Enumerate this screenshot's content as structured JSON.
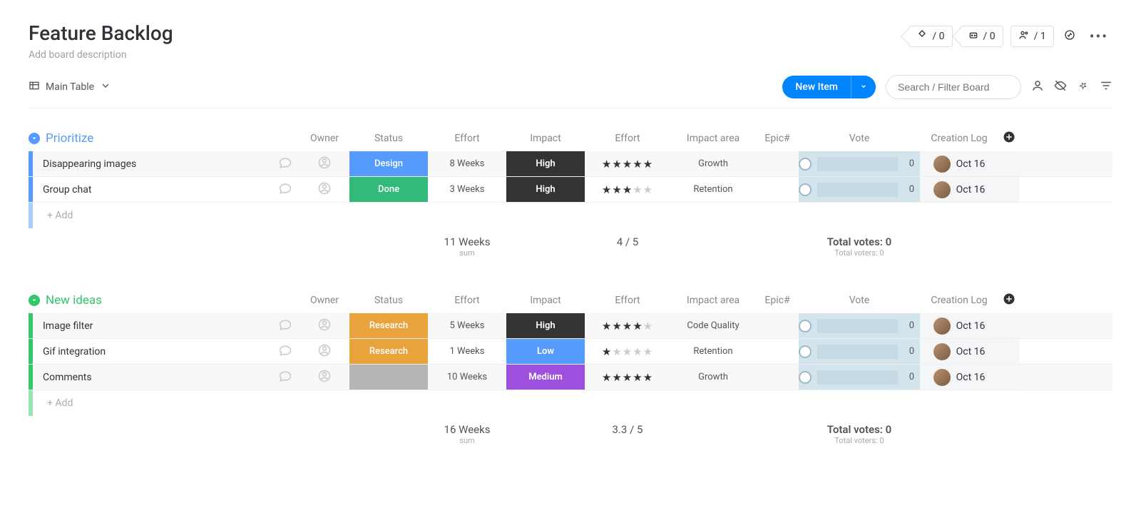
{
  "header": {
    "title": "Feature Backlog",
    "description": "Add board description"
  },
  "topchips": {
    "chip1": "/ 0",
    "chip2": "/ 0",
    "chip3": "/ 1"
  },
  "toolbar": {
    "view": "Main Table",
    "new_item": "New Item",
    "search_placeholder": "Search / Filter Board"
  },
  "columns": [
    "Owner",
    "Status",
    "Effort",
    "Impact",
    "Effort",
    "Impact area",
    "Epic#",
    "Vote",
    "Creation Log"
  ],
  "groups": [
    {
      "name": "Prioritize",
      "color": "#579bfc",
      "rows": [
        {
          "title": "Disappearing images",
          "status": "Design",
          "status_color": "#579bfc",
          "effort": "8 Weeks",
          "impact": "High",
          "impact_color": "#333333",
          "stars": 5,
          "impact_area": "Growth",
          "epic": "",
          "vote": "0",
          "date": "Oct 16"
        },
        {
          "title": "Group chat",
          "status": "Done",
          "status_color": "#33b97a",
          "effort": "3 Weeks",
          "impact": "High",
          "impact_color": "#333333",
          "stars": 3,
          "impact_area": "Retention",
          "epic": "",
          "vote": "0",
          "date": "Oct 16"
        }
      ],
      "add_label": "+ Add",
      "summary": {
        "effort": "11 Weeks",
        "effort_sub": "sum",
        "stars": "4 / 5",
        "votes": "Total votes: 0",
        "voters": "Total voters: 0"
      }
    },
    {
      "name": "New ideas",
      "color": "#33c76a",
      "rows": [
        {
          "title": "Image filter",
          "status": "Research",
          "status_color": "#e8a33d",
          "effort": "5 Weeks",
          "impact": "High",
          "impact_color": "#333333",
          "stars": 4,
          "impact_area": "Code Quality",
          "epic": "",
          "vote": "0",
          "date": "Oct 16"
        },
        {
          "title": "Gif integration",
          "status": "Research",
          "status_color": "#e8a33d",
          "effort": "1 Weeks",
          "impact": "Low",
          "impact_color": "#579bfc",
          "stars": 1,
          "impact_area": "Retention",
          "epic": "",
          "vote": "0",
          "date": "Oct 16"
        },
        {
          "title": "Comments",
          "status": "",
          "status_color": "#b5b5b5",
          "effort": "10 Weeks",
          "impact": "Medium",
          "impact_color": "#9d50dd",
          "stars": 5,
          "impact_area": "Growth",
          "epic": "",
          "vote": "0",
          "date": "Oct 16"
        }
      ],
      "add_label": "+ Add",
      "summary": {
        "effort": "16 Weeks",
        "effort_sub": "sum",
        "stars": "3.3 / 5",
        "votes": "Total votes: 0",
        "voters": "Total voters: 0"
      }
    }
  ]
}
